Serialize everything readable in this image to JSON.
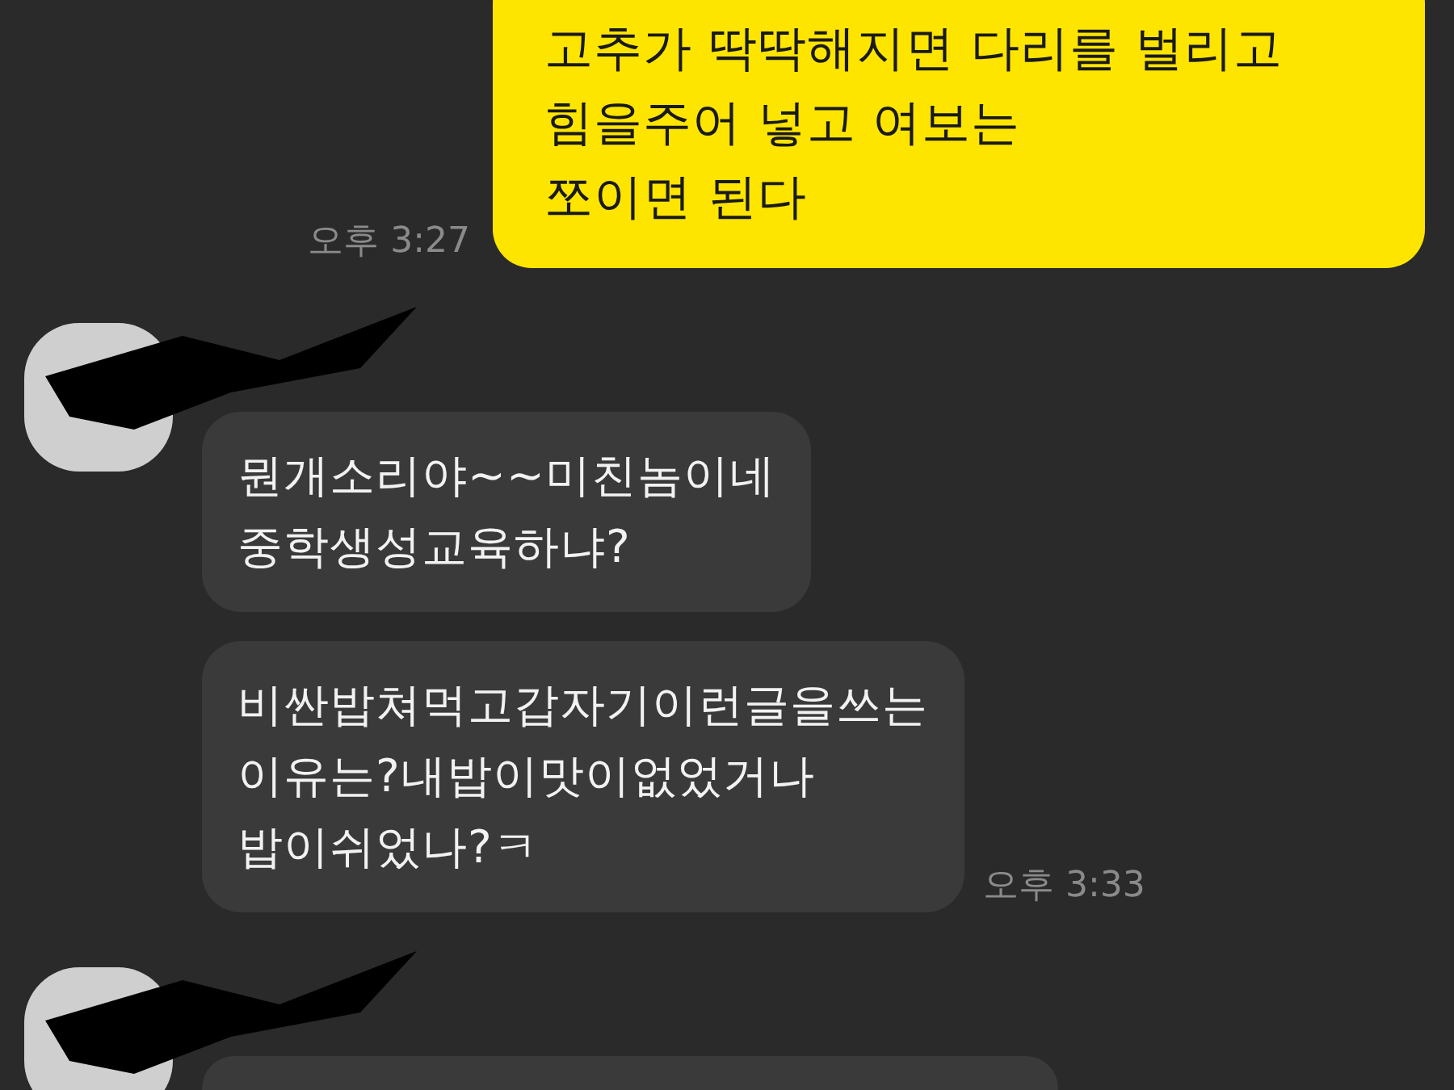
{
  "messages": [
    {
      "kind": "sent",
      "text": "고추가 딱딱해지면 다리를 벌리고\n힘을주어 넣고 여보는\n쪼이면 된다",
      "time": "오후 3:27"
    },
    {
      "kind": "received",
      "avatar": true,
      "text": "뭔개소리야~~미친놈이네\n중학생성교육하냐?"
    },
    {
      "kind": "received",
      "avatar": false,
      "text": "비싼밥쳐먹고갑자기이런글을쓰는\n이유는?내밥이맛이없었거나\n밥이쉬었나?ㅋ",
      "time": "오후 3:33"
    },
    {
      "kind": "received",
      "avatar": true
    }
  ]
}
